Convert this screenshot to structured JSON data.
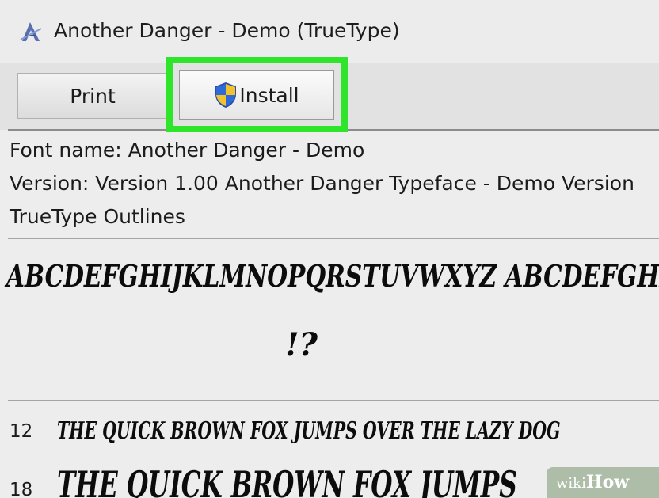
{
  "window": {
    "title": "Another Danger - Demo (TrueType)",
    "app_icon": "font-file-icon"
  },
  "toolbar": {
    "print_label": "Print",
    "install_label": "Install",
    "install_icon": "uac-shield-icon",
    "highlight_color": "#2fe52c"
  },
  "info": {
    "font_name": "Font name: Another Danger - Demo",
    "version": "Version: Version 1.00 Another Danger Typeface - Demo Version",
    "outlines": "TrueType Outlines"
  },
  "preview": {
    "alphabet_line": "ABCDEFGHIJKLMNOPQRSTUVWXYZ ABCDEFGHIJ",
    "punctuation_line": "!?",
    "samples": [
      {
        "size": "12",
        "text": "THE QUICK BROWN FOX JUMPS OVER THE LAZY DOG"
      },
      {
        "size": "18",
        "text": "THE QUICK BROWN FOX JUMPS"
      }
    ]
  },
  "watermark": {
    "prefix": "wiki",
    "suffix": "How"
  }
}
